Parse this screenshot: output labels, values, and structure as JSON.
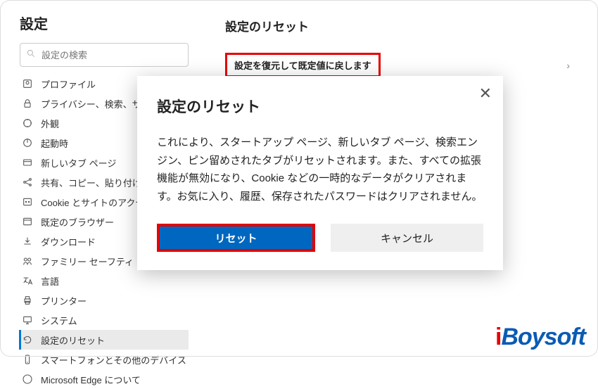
{
  "sidebar": {
    "title": "設定",
    "search_placeholder": "設定の検索",
    "items": [
      {
        "icon": "profile-icon",
        "label": "プロファイル"
      },
      {
        "icon": "lock-icon",
        "label": "プライバシー、検索、サービス"
      },
      {
        "icon": "appearance-icon",
        "label": "外観"
      },
      {
        "icon": "power-icon",
        "label": "起動時"
      },
      {
        "icon": "newtab-icon",
        "label": "新しいタブ ページ"
      },
      {
        "icon": "share-icon",
        "label": "共有、コピー、貼り付け"
      },
      {
        "icon": "cookie-icon",
        "label": "Cookie とサイトのアクセス許"
      },
      {
        "icon": "browser-icon",
        "label": "既定のブラウザー"
      },
      {
        "icon": "download-icon",
        "label": "ダウンロード"
      },
      {
        "icon": "family-icon",
        "label": "ファミリー セーフティ"
      },
      {
        "icon": "language-icon",
        "label": "言語"
      },
      {
        "icon": "printer-icon",
        "label": "プリンター"
      },
      {
        "icon": "system-icon",
        "label": "システム"
      },
      {
        "icon": "reset-icon",
        "label": "設定のリセット",
        "active": true
      },
      {
        "icon": "phone-icon",
        "label": "スマートフォンとその他のデバイス"
      },
      {
        "icon": "about-icon",
        "label": "Microsoft Edge について"
      }
    ]
  },
  "main": {
    "heading": "設定のリセット",
    "reset_entry": "設定を復元して既定値に戻します"
  },
  "dialog": {
    "title": "設定のリセット",
    "body": "これにより、スタートアップ ページ、新しいタブ ページ、検索エンジン、ピン留めされたタブがリセットされます。また、すべての拡張機能が無効になり、Cookie などの一時的なデータがクリアされます。お気に入り、履歴、保存されたパスワードはクリアされません。",
    "primary": "リセット",
    "secondary": "キャンセル"
  },
  "watermark": "iBoysoft",
  "highlight_color": "#e60000",
  "accent_color": "#0067c0"
}
